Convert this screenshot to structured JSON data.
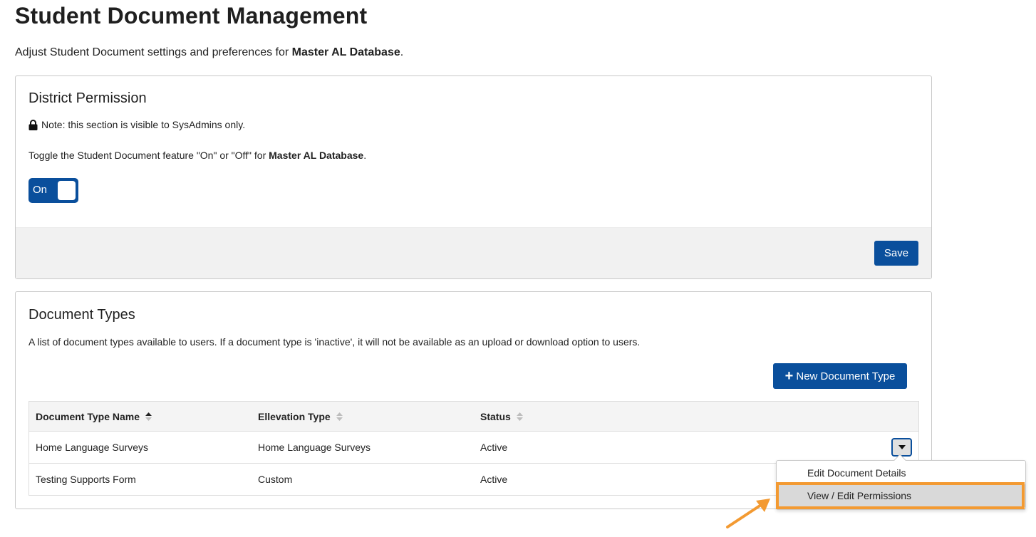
{
  "page": {
    "title": "Student Document Management",
    "subtitle_prefix": "Adjust Student Document settings and preferences for ",
    "database_name": "Master AL Database",
    "subtitle_suffix": "."
  },
  "district_permission": {
    "heading": "District Permission",
    "lock_icon": "lock-icon",
    "note": "Note: this section is visible to SysAdmins only.",
    "toggle_desc_prefix": "Toggle the Student Document feature \"On\" or \"Off\" for ",
    "toggle_desc_db": "Master AL Database",
    "toggle_desc_suffix": ".",
    "toggle_label": "On",
    "toggle_state": true,
    "save_label": "Save"
  },
  "document_types": {
    "heading": "Document Types",
    "description": "A list of document types available to users. If a document type is 'inactive', it will not be available as an upload or download option to users.",
    "new_button_icon": "plus-icon",
    "new_button_label": "New Document Type",
    "columns": [
      "Document Type Name",
      "Ellevation Type",
      "Status"
    ],
    "rows": [
      {
        "name": "Home Language Surveys",
        "type": "Home Language Surveys",
        "status": "Active"
      },
      {
        "name": "Testing Supports Form",
        "type": "Custom",
        "status": "Active"
      }
    ]
  },
  "row_menu": {
    "items": [
      "Edit Document Details",
      "View / Edit Permissions"
    ],
    "highlighted_item": "View / Edit Permissions"
  },
  "colors": {
    "primary": "#0a4f9c",
    "annotation": "#f39a32",
    "footer_bg": "#f1f1f1"
  }
}
